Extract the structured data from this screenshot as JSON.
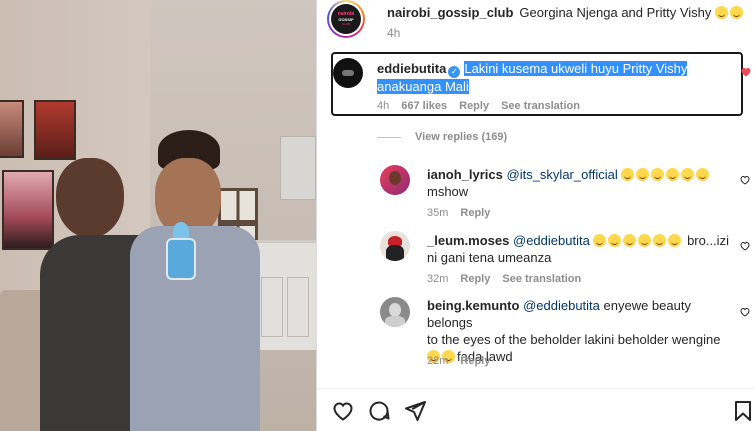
{
  "post": {
    "username": "nairobi_gossip_club",
    "caption": "Georgina Njenga and Pritty Vishy",
    "time": "4h",
    "logo_text": [
      "nairobi",
      "GOSSIP",
      "CLUB"
    ]
  },
  "highlighted_comment": {
    "username": "eddiebutita",
    "text_line1": "Lakini kusema ukweli huyu Pritty Vishy",
    "text_line2": "anakuanga Mali",
    "time": "4h",
    "likes": "667 likes",
    "reply": "Reply",
    "see_translation": "See translation"
  },
  "view_replies": "View replies (169)",
  "replies": [
    {
      "username": "ianoh_lyrics",
      "mention": "@its_skylar_official",
      "text2": "mshow",
      "time": "35m",
      "reply": "Reply"
    },
    {
      "username": "_leum.moses",
      "mention": "@eddiebutita",
      "text1_tail": "bro...izi",
      "text2": "ni gani tena umeanza",
      "time": "32m",
      "reply": "Reply",
      "see_translation": "See translation"
    },
    {
      "username": "being.kemunto",
      "mention": "@eddiebutita",
      "text1_tail": "enyewe beauty belongs",
      "text2": "to the eyes of the beholder lakini beholder wengine",
      "text3": "fada lawd",
      "time": "22m",
      "reply": "Reply"
    }
  ],
  "colors": {
    "link": "#00376b",
    "selection": "#3390ff",
    "heart_liked": "#ed4956",
    "muted": "#8e8e8e",
    "verified": "#3897f0"
  },
  "icons": [
    "heart-icon",
    "comment-icon",
    "share-icon",
    "bookmark-icon",
    "verified-icon"
  ]
}
